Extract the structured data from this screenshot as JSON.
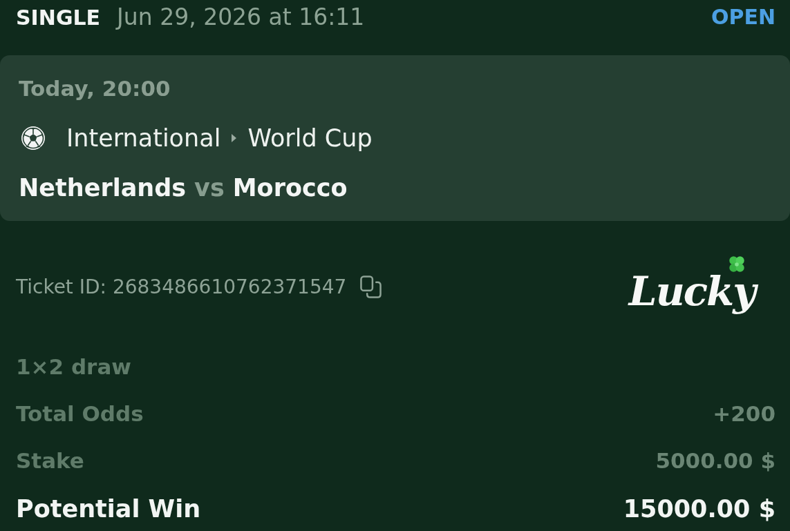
{
  "header": {
    "bet_type": "SINGLE",
    "placed_at": "Jun 29, 2026 at 16:11",
    "status": "OPEN"
  },
  "event": {
    "start": "Today, 20:00",
    "category": "International",
    "competition": "World Cup",
    "home": "Netherlands",
    "separator": "vs",
    "away": "Morocco"
  },
  "ticket": {
    "id_text": "Ticket ID: 2683486610762371547"
  },
  "logo": {
    "text": "Lucky"
  },
  "market": "1×2 draw",
  "summary": [
    {
      "label": "Total Odds",
      "value": "+200",
      "kind": "detail"
    },
    {
      "label": "Stake",
      "value": "5000.00 $",
      "kind": "detail"
    },
    {
      "label": "Potential Win",
      "value": "15000.00 $",
      "kind": "total"
    }
  ]
}
